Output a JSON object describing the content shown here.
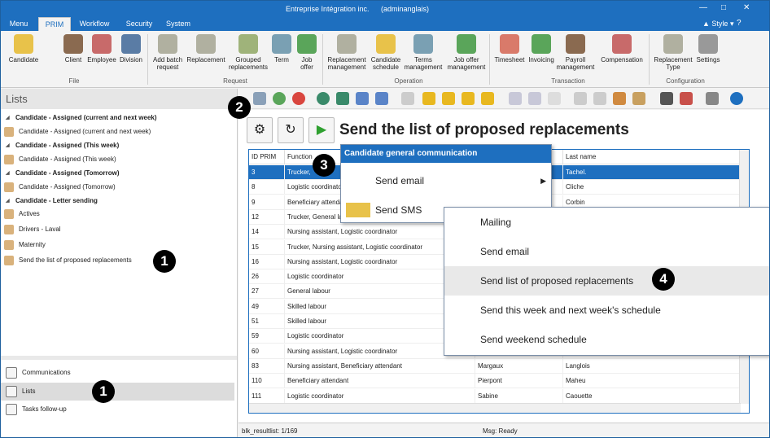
{
  "window": {
    "title": "Entreprise Intégration inc.",
    "user": "(adminanglais)",
    "style_label": "Style"
  },
  "menu_tabs": [
    "Menu",
    "PRIM",
    "Workflow",
    "Security",
    "System"
  ],
  "ribbon": {
    "buttons": [
      "Candidate",
      "Client",
      "Employee",
      "Division",
      "Add batch request",
      "Replacement",
      "Grouped replacements",
      "Term",
      "Job offer",
      "Replacement management",
      "Candidate schedule",
      "Terms management",
      "Job offer management",
      "Timesheet",
      "Invoicing",
      "Payroll management",
      "Compensation",
      "Replacement Type",
      "Settings"
    ],
    "groups": [
      "File",
      "Request",
      "Operation",
      "Transaction",
      "Configuration"
    ]
  },
  "left": {
    "title": "Lists",
    "items": [
      {
        "label": "Candidate - Assigned (current and next week)",
        "type": "group"
      },
      {
        "label": "Candidate - Assigned (current and next week)",
        "type": "item"
      },
      {
        "label": "Candidate - Assigned (This week)",
        "type": "group"
      },
      {
        "label": "Candidate - Assigned (This week)",
        "type": "item"
      },
      {
        "label": "Candidate - Assigned (Tomorrow)",
        "type": "group"
      },
      {
        "label": "Candidate - Assigned (Tomorrow)",
        "type": "item"
      },
      {
        "label": "Candidate - Letter sending",
        "type": "group"
      },
      {
        "label": "Actives",
        "type": "item"
      },
      {
        "label": "Drivers - Laval",
        "type": "item"
      },
      {
        "label": "Maternity",
        "type": "item"
      },
      {
        "label": "Send the list of proposed replacements",
        "type": "item"
      }
    ],
    "nav": [
      "Communications",
      "Lists",
      "Tasks follow-up"
    ]
  },
  "main": {
    "heading": "Send the list of proposed replacements"
  },
  "grid": {
    "columns": [
      "ID PRIM",
      "Function",
      "",
      "Last name"
    ],
    "rows": [
      [
        "3",
        "Trucker,",
        "",
        "Tachel."
      ],
      [
        "8",
        "Logistic coordinator",
        "",
        "Cliche"
      ],
      [
        "9",
        "Beneficiary attendant",
        "",
        "Corbin"
      ],
      [
        "12",
        "Trucker, General labour",
        "",
        ""
      ],
      [
        "14",
        "Nursing assistant, Logistic coordinator",
        "",
        ""
      ],
      [
        "15",
        "Trucker, Nursing assistant, Logistic coordinator",
        "",
        ""
      ],
      [
        "16",
        "Nursing assistant, Logistic coordinator",
        "",
        ""
      ],
      [
        "26",
        "Logistic coordinator",
        "",
        ""
      ],
      [
        "27",
        "General labour",
        "",
        ""
      ],
      [
        "49",
        "Skilled labour",
        "",
        ""
      ],
      [
        "51",
        "Skilled labour",
        "",
        ""
      ],
      [
        "59",
        "Logistic coordinator",
        "",
        ""
      ],
      [
        "60",
        "Nursing assistant, Logistic coordinator",
        "",
        ""
      ],
      [
        "83",
        "Nursing assistant, Beneficiary attendant",
        "Margaux",
        "Langlois"
      ],
      [
        "110",
        "Beneficiary attendant",
        "Pierpont",
        "Maheu"
      ],
      [
        "111",
        "Logistic coordinator",
        "Sabine",
        "Caouette"
      ]
    ]
  },
  "status": {
    "left": "blk_resultlist: 1/169",
    "right": "Msg: Ready"
  },
  "menu1": {
    "header": "Candidate general communication",
    "items": [
      "Send email",
      "Send SMS"
    ]
  },
  "menu2": {
    "items": [
      "Mailing",
      "Send email",
      "Send list of proposed replacements",
      "Send this week and next week's schedule",
      "Send weekend schedule"
    ]
  },
  "callouts": [
    "1",
    "1",
    "2",
    "3",
    "4"
  ],
  "colors": {
    "accent": "#1e6fbf"
  }
}
